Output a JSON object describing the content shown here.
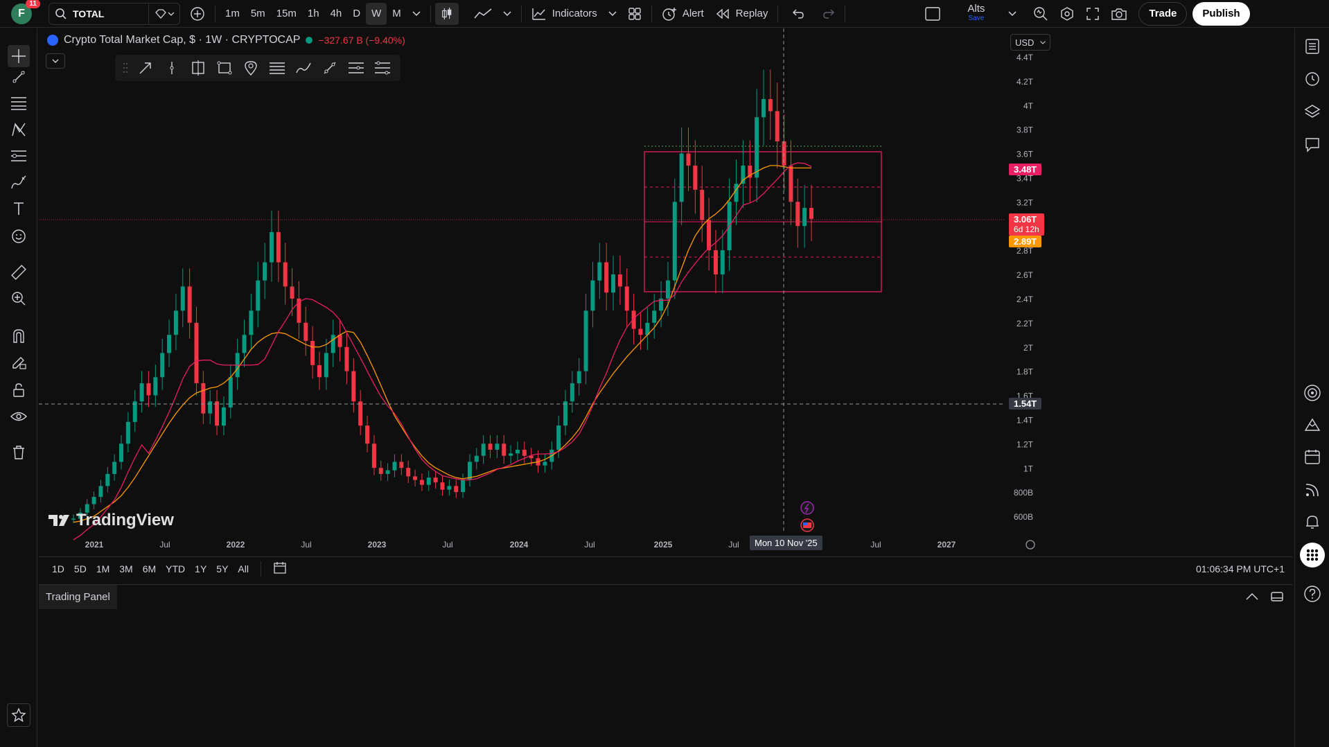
{
  "topbar": {
    "avatar_letter": "F",
    "notif_count": "11",
    "symbol": "TOTAL",
    "timeframes": [
      "1m",
      "5m",
      "15m",
      "1h",
      "4h",
      "D",
      "W",
      "M"
    ],
    "active_timeframe": "W",
    "indicators_label": "Indicators",
    "alert_label": "Alert",
    "replay_label": "Replay",
    "layout_name": "Alts",
    "layout_save": "Save",
    "trade_label": "Trade",
    "publish_label": "Publish"
  },
  "legend": {
    "title": "Crypto Total Market Cap, $ · 1W · CRYPTOCAP",
    "change": "−327.67 B (−9.40%)"
  },
  "currency": "USD",
  "price_axis": {
    "ticks": [
      "4.4T",
      "4.2T",
      "4T",
      "3.8T",
      "3.6T",
      "3.4T",
      "3.2T",
      "3T",
      "2.8T",
      "2.6T",
      "2.4T",
      "2.2T",
      "2T",
      "1.8T",
      "1.6T",
      "1.4T",
      "1.2T",
      "1T",
      "800B",
      "600B"
    ],
    "tags": {
      "ma_fast": "3.48T",
      "last_price": "3.06T",
      "countdown": "6d 12h",
      "ma_slow": "2.89T",
      "crosshair": "1.54T"
    }
  },
  "time_axis": {
    "labels": [
      "2021",
      "Jul",
      "2022",
      "Jul",
      "2023",
      "Jul",
      "2024",
      "Jul",
      "2025",
      "Jul",
      "Jul",
      "2027"
    ],
    "crosshair_label": "Mon 10 Nov '25"
  },
  "branding": "TradingView",
  "rangebar": {
    "ranges": [
      "1D",
      "5D",
      "1M",
      "3M",
      "6M",
      "YTD",
      "1Y",
      "5Y",
      "All"
    ],
    "clock": "01:06:34 PM UTC+1"
  },
  "trading_panel": "Trading Panel",
  "colors": {
    "bull": "#089981",
    "bear": "#f23645",
    "ma_fast": "#e91e63",
    "ma_slow": "#ff9800",
    "box": "#e91e63"
  },
  "chart_data": {
    "type": "candlestick",
    "title": "Crypto Total Market Cap, $ · 1W · CRYPTOCAP",
    "ylim": [
      0.55,
      4.45
    ],
    "y_unit": "T",
    "overlays": [
      "MA fast (pink)",
      "MA slow (orange)",
      "rectangle zone 2.47T–3.62T"
    ],
    "x_start": "2020-12",
    "x_end": "2025-11",
    "points": [
      [
        0.58,
        0.55
      ],
      [
        0.63,
        0.56
      ],
      [
        0.7,
        0.58
      ],
      [
        0.76,
        0.6
      ],
      [
        0.85,
        0.64
      ],
      [
        0.95,
        0.68
      ],
      [
        1.05,
        0.72
      ],
      [
        1.2,
        0.77
      ],
      [
        1.38,
        0.84
      ],
      [
        1.55,
        0.92
      ],
      [
        1.7,
        1.01
      ],
      [
        1.6,
        1.1
      ],
      [
        1.75,
        1.19
      ],
      [
        1.95,
        1.28
      ],
      [
        2.1,
        1.37
      ],
      [
        2.3,
        1.45
      ],
      [
        2.5,
        1.52
      ],
      [
        2.2,
        1.58
      ],
      [
        1.7,
        1.62
      ],
      [
        1.45,
        1.64
      ],
      [
        1.55,
        1.66
      ],
      [
        1.35,
        1.67
      ],
      [
        1.5,
        1.7
      ],
      [
        1.75,
        1.75
      ],
      [
        1.95,
        1.82
      ],
      [
        2.1,
        1.9
      ],
      [
        2.3,
        1.98
      ],
      [
        2.55,
        2.04
      ],
      [
        2.7,
        2.08
      ],
      [
        2.95,
        2.11
      ],
      [
        2.7,
        2.12
      ],
      [
        2.5,
        2.11
      ],
      [
        2.4,
        2.08
      ],
      [
        2.2,
        2.05
      ],
      [
        2.05,
        2.02
      ],
      [
        1.85,
        2.0
      ],
      [
        1.75,
        2.0
      ],
      [
        1.95,
        2.02
      ],
      [
        2.1,
        2.06
      ],
      [
        2.0,
        2.1
      ],
      [
        1.8,
        2.13
      ],
      [
        1.55,
        2.12
      ],
      [
        1.35,
        2.04
      ],
      [
        1.2,
        1.93
      ],
      [
        1.0,
        1.81
      ],
      [
        0.95,
        1.68
      ],
      [
        0.98,
        1.55
      ],
      [
        1.05,
        1.43
      ],
      [
        1.0,
        1.34
      ],
      [
        0.93,
        1.25
      ],
      [
        0.9,
        1.17
      ],
      [
        0.86,
        1.1
      ],
      [
        0.92,
        1.04
      ],
      [
        0.88,
        1.0
      ],
      [
        0.82,
        0.97
      ],
      [
        0.85,
        0.94
      ],
      [
        0.8,
        0.92
      ],
      [
        0.9,
        0.91
      ],
      [
        1.05,
        0.92
      ],
      [
        1.1,
        0.93
      ],
      [
        1.2,
        0.95
      ],
      [
        1.15,
        0.97
      ],
      [
        1.2,
        0.99
      ],
      [
        1.1,
        1.0
      ],
      [
        1.12,
        1.01
      ],
      [
        1.15,
        1.02
      ],
      [
        1.1,
        1.03
      ],
      [
        1.08,
        1.04
      ],
      [
        1.02,
        1.05
      ],
      [
        1.05,
        1.07
      ],
      [
        1.15,
        1.1
      ],
      [
        1.35,
        1.14
      ],
      [
        1.55,
        1.19
      ],
      [
        1.7,
        1.25
      ],
      [
        1.8,
        1.32
      ],
      [
        2.3,
        1.42
      ],
      [
        2.55,
        1.53
      ],
      [
        2.7,
        1.62
      ],
      [
        2.45,
        1.7
      ],
      [
        2.6,
        1.78
      ],
      [
        2.5,
        1.85
      ],
      [
        2.3,
        1.92
      ],
      [
        2.15,
        1.98
      ],
      [
        2.1,
        2.04
      ],
      [
        2.2,
        2.1
      ],
      [
        2.3,
        2.16
      ],
      [
        2.4,
        2.24
      ],
      [
        2.55,
        2.35
      ],
      [
        3.2,
        2.5
      ],
      [
        3.6,
        2.65
      ],
      [
        3.5,
        2.8
      ],
      [
        3.3,
        2.92
      ],
      [
        3.05,
        3.0
      ],
      [
        2.8,
        3.06
      ],
      [
        2.6,
        3.1
      ],
      [
        2.8,
        3.15
      ],
      [
        3.2,
        3.22
      ],
      [
        3.35,
        3.3
      ],
      [
        3.5,
        3.38
      ],
      [
        3.4,
        3.42
      ],
      [
        3.9,
        3.45
      ],
      [
        4.05,
        3.48
      ],
      [
        3.95,
        3.5
      ],
      [
        3.7,
        3.5
      ],
      [
        3.5,
        3.49
      ],
      [
        3.2,
        3.48
      ],
      [
        3.0,
        3.48
      ],
      [
        3.15,
        3.48
      ],
      [
        3.06,
        3.48
      ]
    ]
  }
}
